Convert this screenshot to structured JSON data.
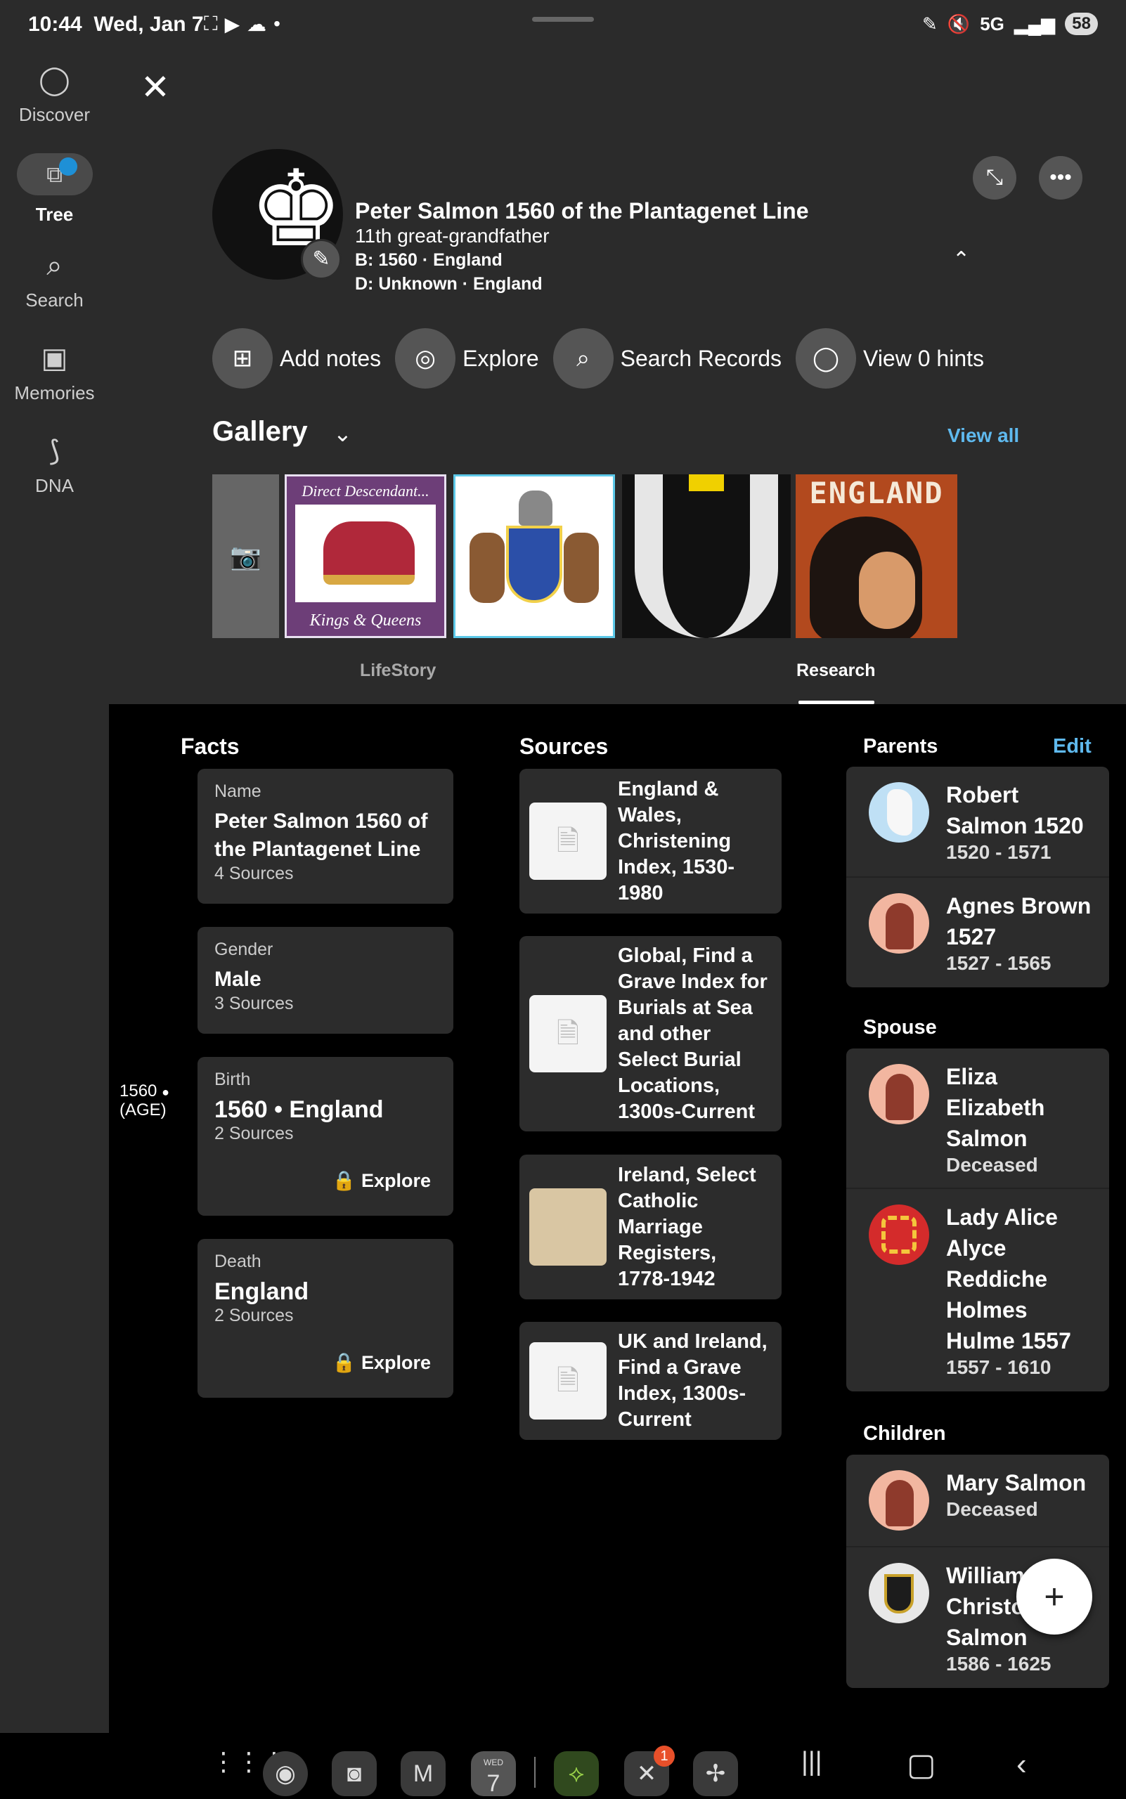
{
  "status_bar": {
    "time": "10:44",
    "date": "Wed, Jan 7",
    "network": "5G",
    "battery": "58"
  },
  "rail": {
    "discover": "Discover",
    "tree": "Tree",
    "search": "Search",
    "memories": "Memories",
    "dna": "DNA"
  },
  "person": {
    "name": "Peter Salmon 1560 of the Plantagenet Line",
    "relation": "11th great-grandfather",
    "birth": "B: 1560 · England",
    "death": "D: Unknown · England"
  },
  "actions": {
    "add_notes": "Add notes",
    "explore": "Explore",
    "search_records": "Search Records",
    "view_hints": "View 0 hints"
  },
  "gallery": {
    "title": "Gallery",
    "view_all": "View all",
    "thumb1_top": "Direct Descendant...",
    "thumb1_bottom": "Kings & Queens",
    "thumb4_text": "ENGLAND"
  },
  "tabs": {
    "lifestory": "LifeStory",
    "research": "Research"
  },
  "facts": {
    "heading": "Facts",
    "name_label": "Name",
    "name_value": "Peter Salmon 1560 of the Plantagenet Line",
    "name_sources": "4 Sources",
    "gender_label": "Gender",
    "gender_value": "Male",
    "gender_sources": "3 Sources",
    "birth_label": "Birth",
    "birth_value": "1560 • England",
    "birth_sources": "2 Sources",
    "birth_year": "1560",
    "birth_age": "(AGE)",
    "death_label": "Death",
    "death_value": "England",
    "death_sources": "2 Sources",
    "explore": "Explore"
  },
  "sources": {
    "heading": "Sources",
    "items": [
      "England & Wales, Christening Index, 1530-1980",
      "Global, Find a Grave Index for Burials at Sea and other Select Burial Locations, 1300s-Current",
      "Ireland, Select Catholic Marriage Registers, 1778-1942",
      "UK and Ireland, Find a Grave Index, 1300s-Current"
    ]
  },
  "relatives": {
    "parents_heading": "Parents",
    "edit": "Edit",
    "parents": [
      {
        "name": "Robert Salmon 1520",
        "dates": "1520 - 1571"
      },
      {
        "name": "Agnes Brown 1527",
        "dates": "1527 - 1565"
      }
    ],
    "spouse_heading": "Spouse",
    "spouses": [
      {
        "name": "Eliza Elizabeth Salmon",
        "dates": "Deceased"
      },
      {
        "name": "Lady Alice Alyce Reddiche Holmes Hulme 1557",
        "dates": "1557 - 1610"
      }
    ],
    "children_heading": "Children",
    "children": [
      {
        "name": "Mary Salmon",
        "dates": "Deceased"
      },
      {
        "name": "William Christo Salmon",
        "dates": "1586 - 1625"
      }
    ]
  },
  "navbar": {
    "calendar_day": "7",
    "calendar_wd": "WED",
    "badge": "1"
  },
  "colors": {
    "accent": "#5fb9ee",
    "panel": "#2b2b2b",
    "card": "#2c2c2c",
    "notification_dot": "#1e90d6"
  }
}
